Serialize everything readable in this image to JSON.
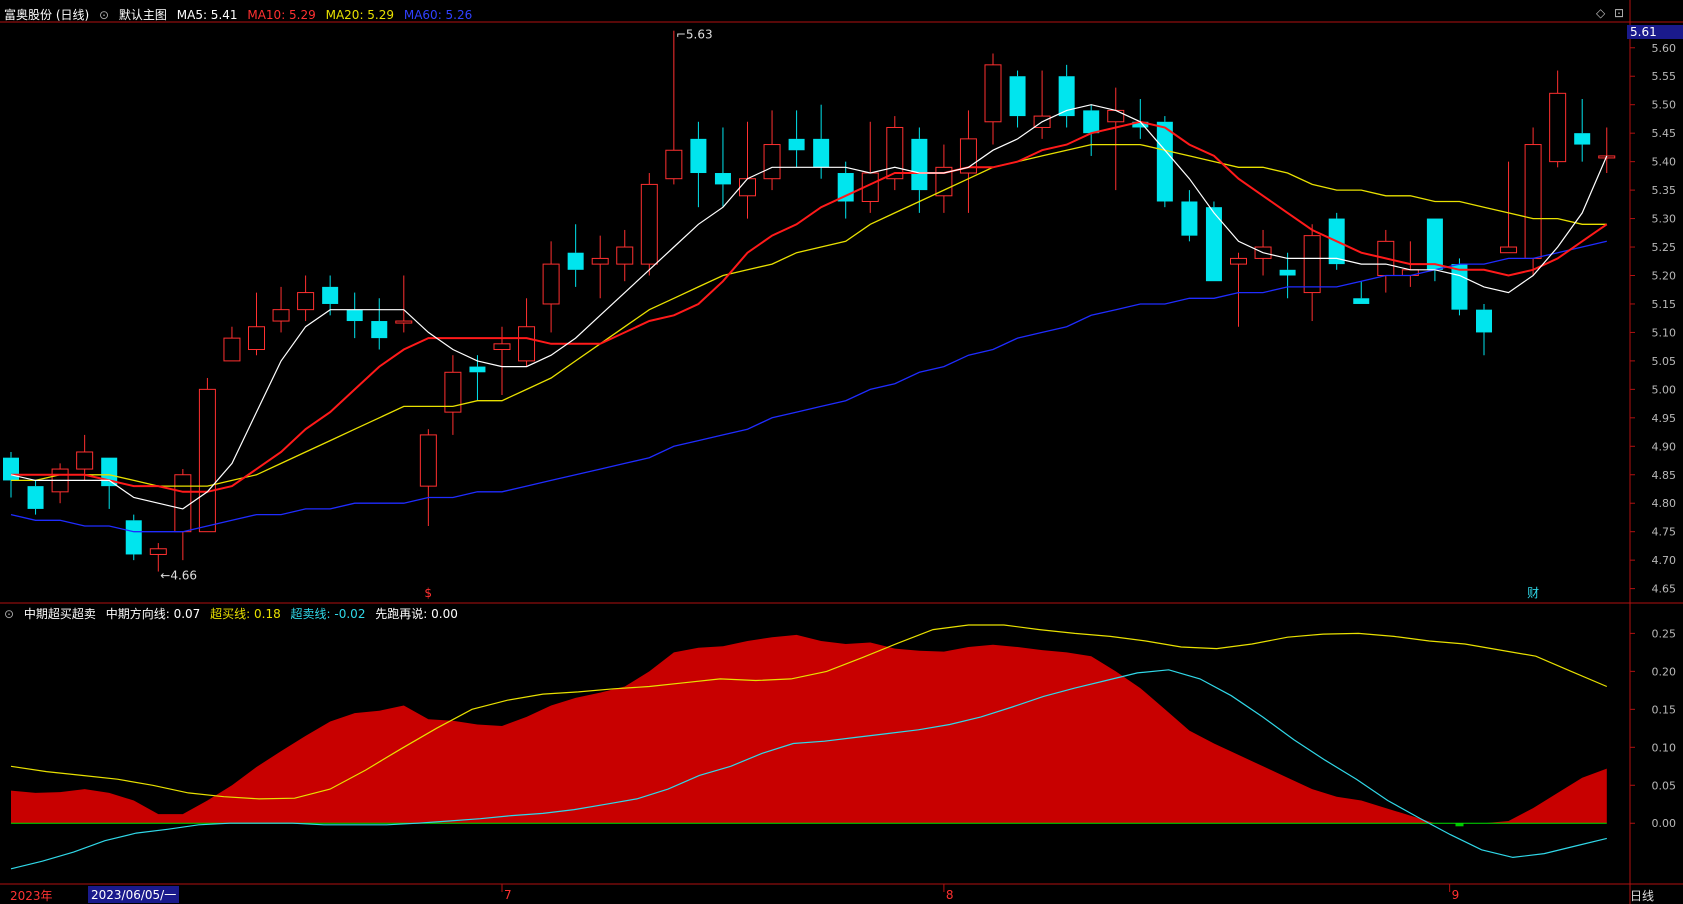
{
  "header": {
    "stock": "富奥股份 (日线)",
    "template": "默认主图",
    "ma5_label": "MA5: 5.41",
    "ma10_label": "MA10: 5.29",
    "ma20_label": "MA20: 5.29",
    "ma60_label": "MA60: 5.26"
  },
  "sub_header": {
    "title": "中期超买超卖",
    "dir_label": "中期方向线: 0.07",
    "ob_label": "超买线: 0.18",
    "os_label": "超卖线: -0.02",
    "misc_label": "先跑再说: 0.00"
  },
  "colors": {
    "up": "#ff3030",
    "down": "#00e5ee",
    "ma5": "#ffffff",
    "ma10": "#ff1a1a",
    "ma20": "#e8e000",
    "ma60": "#1f2cff",
    "ob_line": "#e8e000",
    "os_line": "#30d8e8",
    "area": "#c80000"
  },
  "chart_data": [
    {
      "type": "candlestick",
      "y_ticks": [
        "5.60",
        "5.55",
        "5.50",
        "5.45",
        "5.40",
        "5.35",
        "5.30",
        "5.25",
        "5.20",
        "5.15",
        "5.10",
        "5.05",
        "5.00",
        "4.95",
        "4.90",
        "4.85",
        "4.80",
        "4.75",
        "4.70",
        "4.65"
      ],
      "ylim": [
        4.63,
        5.64
      ],
      "last_price": "5.61",
      "high_label": "5.63",
      "low_label": "4.66",
      "event_markers": [
        "$",
        "财"
      ],
      "candles": [
        [
          4.88,
          4.84,
          4.89,
          4.81
        ],
        [
          4.83,
          4.79,
          4.84,
          4.78
        ],
        [
          4.82,
          4.86,
          4.87,
          4.8
        ],
        [
          4.86,
          4.89,
          4.92,
          4.84
        ],
        [
          4.88,
          4.83,
          4.88,
          4.79
        ],
        [
          4.77,
          4.71,
          4.78,
          4.7
        ],
        [
          4.71,
          4.72,
          4.73,
          4.68
        ],
        [
          4.75,
          4.85,
          4.86,
          4.7
        ],
        [
          4.75,
          5.0,
          5.02,
          4.75
        ],
        [
          5.05,
          5.09,
          5.11,
          5.05
        ],
        [
          5.07,
          5.11,
          5.17,
          5.06
        ],
        [
          5.12,
          5.14,
          5.18,
          5.1
        ],
        [
          5.14,
          5.17,
          5.2,
          5.12
        ],
        [
          5.18,
          5.15,
          5.2,
          5.13
        ],
        [
          5.14,
          5.12,
          5.17,
          5.09
        ],
        [
          5.12,
          5.09,
          5.16,
          5.07
        ],
        [
          5.12,
          5.12,
          5.2,
          5.1
        ],
        [
          4.83,
          4.92,
          4.93,
          4.76
        ],
        [
          4.96,
          5.03,
          5.06,
          4.92
        ],
        [
          5.04,
          5.03,
          5.06,
          4.98
        ],
        [
          5.07,
          5.08,
          5.11,
          4.99
        ],
        [
          5.05,
          5.11,
          5.16,
          5.04
        ],
        [
          5.15,
          5.22,
          5.26,
          5.1
        ],
        [
          5.24,
          5.21,
          5.29,
          5.18
        ],
        [
          5.22,
          5.23,
          5.27,
          5.16
        ],
        [
          5.22,
          5.25,
          5.28,
          5.19
        ],
        [
          5.22,
          5.36,
          5.38,
          5.2
        ],
        [
          5.37,
          5.42,
          5.63,
          5.36
        ],
        [
          5.44,
          5.38,
          5.47,
          5.32
        ],
        [
          5.38,
          5.36,
          5.46,
          5.32
        ],
        [
          5.34,
          5.37,
          5.47,
          5.3
        ],
        [
          5.37,
          5.43,
          5.49,
          5.35
        ],
        [
          5.44,
          5.42,
          5.49,
          5.39
        ],
        [
          5.44,
          5.39,
          5.5,
          5.37
        ],
        [
          5.38,
          5.33,
          5.4,
          5.3
        ],
        [
          5.33,
          5.38,
          5.47,
          5.31
        ],
        [
          5.37,
          5.46,
          5.48,
          5.35
        ],
        [
          5.44,
          5.35,
          5.46,
          5.31
        ],
        [
          5.34,
          5.39,
          5.43,
          5.31
        ],
        [
          5.38,
          5.44,
          5.49,
          5.31
        ],
        [
          5.47,
          5.57,
          5.59,
          5.43
        ],
        [
          5.55,
          5.48,
          5.56,
          5.46
        ],
        [
          5.46,
          5.48,
          5.56,
          5.44
        ],
        [
          5.55,
          5.48,
          5.57,
          5.46
        ],
        [
          5.49,
          5.45,
          5.5,
          5.41
        ],
        [
          5.47,
          5.49,
          5.53,
          5.35
        ],
        [
          5.47,
          5.46,
          5.51,
          5.44
        ],
        [
          5.47,
          5.33,
          5.48,
          5.32
        ],
        [
          5.33,
          5.27,
          5.35,
          5.26
        ],
        [
          5.32,
          5.19,
          5.33,
          5.19
        ],
        [
          5.22,
          5.23,
          5.24,
          5.11
        ],
        [
          5.23,
          5.25,
          5.28,
          5.2
        ],
        [
          5.21,
          5.2,
          5.24,
          5.16
        ],
        [
          5.17,
          5.27,
          5.29,
          5.12
        ],
        [
          5.3,
          5.22,
          5.31,
          5.21
        ],
        [
          5.16,
          5.15,
          5.19,
          5.15
        ],
        [
          5.2,
          5.26,
          5.28,
          5.17
        ],
        [
          5.2,
          5.21,
          5.26,
          5.18
        ],
        [
          5.3,
          5.21,
          5.3,
          5.19
        ],
        [
          5.22,
          5.14,
          5.23,
          5.13
        ],
        [
          5.14,
          5.1,
          5.15,
          5.06
        ],
        [
          5.24,
          5.25,
          5.4,
          5.24
        ],
        [
          5.23,
          5.43,
          5.46,
          5.2
        ],
        [
          5.4,
          5.52,
          5.56,
          5.39
        ],
        [
          5.45,
          5.43,
          5.51,
          5.4
        ],
        [
          5.41,
          5.41,
          5.46,
          5.38
        ]
      ],
      "ma5": [
        4.85,
        4.84,
        4.84,
        4.84,
        4.84,
        4.81,
        4.8,
        4.79,
        4.82,
        4.87,
        4.96,
        5.05,
        5.11,
        5.14,
        5.14,
        5.14,
        5.14,
        5.1,
        5.07,
        5.05,
        5.04,
        5.04,
        5.06,
        5.09,
        5.13,
        5.17,
        5.21,
        5.25,
        5.29,
        5.32,
        5.37,
        5.39,
        5.39,
        5.39,
        5.39,
        5.38,
        5.39,
        5.38,
        5.38,
        5.39,
        5.42,
        5.44,
        5.47,
        5.49,
        5.5,
        5.49,
        5.47,
        5.42,
        5.37,
        5.31,
        5.26,
        5.24,
        5.23,
        5.23,
        5.23,
        5.22,
        5.22,
        5.21,
        5.21,
        5.2,
        5.18,
        5.17,
        5.2,
        5.25,
        5.31,
        5.41
      ],
      "ma10": [
        4.85,
        4.85,
        4.85,
        4.85,
        4.84,
        4.83,
        4.83,
        4.82,
        4.82,
        4.83,
        4.86,
        4.89,
        4.93,
        4.96,
        5.0,
        5.04,
        5.07,
        5.09,
        5.09,
        5.09,
        5.09,
        5.09,
        5.08,
        5.08,
        5.08,
        5.1,
        5.12,
        5.13,
        5.15,
        5.19,
        5.24,
        5.27,
        5.29,
        5.32,
        5.34,
        5.36,
        5.38,
        5.38,
        5.38,
        5.39,
        5.39,
        5.4,
        5.42,
        5.43,
        5.45,
        5.46,
        5.47,
        5.46,
        5.43,
        5.41,
        5.37,
        5.34,
        5.31,
        5.28,
        5.26,
        5.24,
        5.23,
        5.22,
        5.22,
        5.21,
        5.21,
        5.2,
        5.21,
        5.23,
        5.26,
        5.29
      ],
      "ma20": [
        4.84,
        4.84,
        4.85,
        4.85,
        4.85,
        4.84,
        4.83,
        4.83,
        4.83,
        4.84,
        4.85,
        4.87,
        4.89,
        4.91,
        4.93,
        4.95,
        4.97,
        4.97,
        4.97,
        4.98,
        4.98,
        5.0,
        5.02,
        5.05,
        5.08,
        5.11,
        5.14,
        5.16,
        5.18,
        5.2,
        5.21,
        5.22,
        5.24,
        5.25,
        5.26,
        5.29,
        5.31,
        5.33,
        5.35,
        5.37,
        5.39,
        5.4,
        5.41,
        5.42,
        5.43,
        5.43,
        5.43,
        5.42,
        5.41,
        5.4,
        5.39,
        5.39,
        5.38,
        5.36,
        5.35,
        5.35,
        5.34,
        5.34,
        5.33,
        5.33,
        5.32,
        5.31,
        5.3,
        5.3,
        5.29,
        5.29
      ],
      "ma60": [
        4.78,
        4.77,
        4.77,
        4.76,
        4.76,
        4.75,
        4.75,
        4.75,
        4.76,
        4.77,
        4.78,
        4.78,
        4.79,
        4.79,
        4.8,
        4.8,
        4.8,
        4.81,
        4.81,
        4.82,
        4.82,
        4.83,
        4.84,
        4.85,
        4.86,
        4.87,
        4.88,
        4.9,
        4.91,
        4.92,
        4.93,
        4.95,
        4.96,
        4.97,
        4.98,
        5.0,
        5.01,
        5.03,
        5.04,
        5.06,
        5.07,
        5.09,
        5.1,
        5.11,
        5.13,
        5.14,
        5.15,
        5.15,
        5.16,
        5.16,
        5.17,
        5.17,
        5.18,
        5.18,
        5.18,
        5.19,
        5.2,
        5.2,
        5.21,
        5.22,
        5.22,
        5.23,
        5.23,
        5.24,
        5.25,
        5.26
      ]
    },
    {
      "type": "area",
      "y_ticks": [
        "0.25",
        "0.20",
        "0.15",
        "0.10",
        "0.05",
        "0.00"
      ],
      "ylim": [
        -0.08,
        0.29
      ],
      "x_labels": [
        "2023年",
        "2023/06/05/一",
        "7",
        "8",
        "9"
      ],
      "direction": [
        0.043,
        0.04,
        0.041,
        0.045,
        0.04,
        0.03,
        0.012,
        0.012,
        0.03,
        0.05,
        0.074,
        0.095,
        0.115,
        0.134,
        0.145,
        0.148,
        0.155,
        0.137,
        0.135,
        0.13,
        0.128,
        0.14,
        0.155,
        0.165,
        0.172,
        0.18,
        0.2,
        0.225,
        0.231,
        0.233,
        0.24,
        0.245,
        0.248,
        0.24,
        0.236,
        0.238,
        0.23,
        0.227,
        0.226,
        0.232,
        0.235,
        0.232,
        0.228,
        0.225,
        0.22,
        0.2,
        0.178,
        0.15,
        0.122,
        0.105,
        0.09,
        0.075,
        0.06,
        0.045,
        0.035,
        0.03,
        0.02,
        0.01,
        0.0,
        -0.004,
        0.0,
        0.003,
        0.02,
        0.04,
        0.06,
        0.072
      ],
      "overbought": [
        0.075,
        0.068,
        0.063,
        0.058,
        0.05,
        0.04,
        0.035,
        0.032,
        0.033,
        0.045,
        0.07,
        0.098,
        0.125,
        0.15,
        0.162,
        0.17,
        0.173,
        0.177,
        0.18,
        0.185,
        0.19,
        0.188,
        0.19,
        0.2,
        0.218,
        0.237,
        0.255,
        0.261,
        0.261,
        0.255,
        0.25,
        0.246,
        0.24,
        0.232,
        0.23,
        0.236,
        0.245,
        0.249,
        0.25,
        0.246,
        0.24,
        0.236,
        0.228,
        0.22,
        0.2,
        0.18
      ],
      "oversold": [
        -0.06,
        -0.05,
        -0.038,
        -0.023,
        -0.013,
        -0.008,
        -0.002,
        0.0,
        0.0,
        0.0,
        -0.002,
        -0.002,
        -0.002,
        0.0,
        0.003,
        0.006,
        0.01,
        0.013,
        0.018,
        0.025,
        0.032,
        0.045,
        0.063,
        0.075,
        0.092,
        0.105,
        0.108,
        0.113,
        0.118,
        0.123,
        0.13,
        0.14,
        0.153,
        0.167,
        0.178,
        0.188,
        0.198,
        0.202,
        0.19,
        0.168,
        0.14,
        0.11,
        0.083,
        0.058,
        0.03,
        0.007,
        -0.015,
        -0.035,
        -0.045,
        -0.04,
        -0.03,
        -0.02
      ]
    }
  ]
}
